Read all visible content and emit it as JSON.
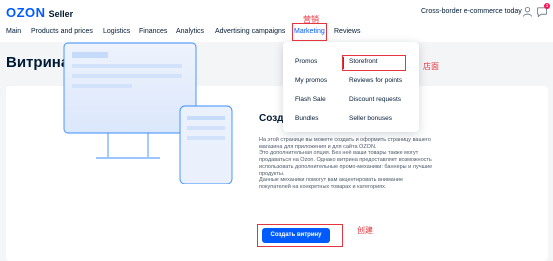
{
  "header": {
    "brand": "OZON",
    "brand_suffix": "Seller",
    "cross_border_link": "Cross-border e-commerce today",
    "notification_count": "3"
  },
  "nav": {
    "items": [
      "Main",
      "Products and prices",
      "Logistics",
      "Finances",
      "Analytics",
      "Advertising campaigns",
      "Marketing",
      "Reviews"
    ],
    "active": "Marketing"
  },
  "page": {
    "title": "Витрина"
  },
  "dropdown": {
    "col1": [
      "Promos",
      "My promos",
      "Flash Sale",
      "Bundles"
    ],
    "col2": [
      "Storefront",
      "Reviews for points",
      "Discount requests",
      "Seller bonuses"
    ],
    "selected": "Storefront"
  },
  "content": {
    "title_partial": "Созд",
    "description": "На этой странице вы можете создать и оформить страницу вашего\nмагазина для приложения и для сайта OZON.\nЭто дополнительная опция. Без неё ваши товары также могут\nпродаваться на Ozon. Однако витрина предоставляет возможность\nиспользовать дополнительные промо-механики: баннеры и лучшие\nпродукты.\nДанные механики помогут вам акцентировать внимание\nпокупателей на конкретных товарах и категориях.",
    "create_button": "Создать витрину"
  },
  "annotations": {
    "marketing": "营销",
    "storefront": "店面",
    "create": "创建"
  },
  "colors": {
    "accent": "#005bff",
    "annotation": "#e5363f",
    "badge": "#f91155"
  }
}
